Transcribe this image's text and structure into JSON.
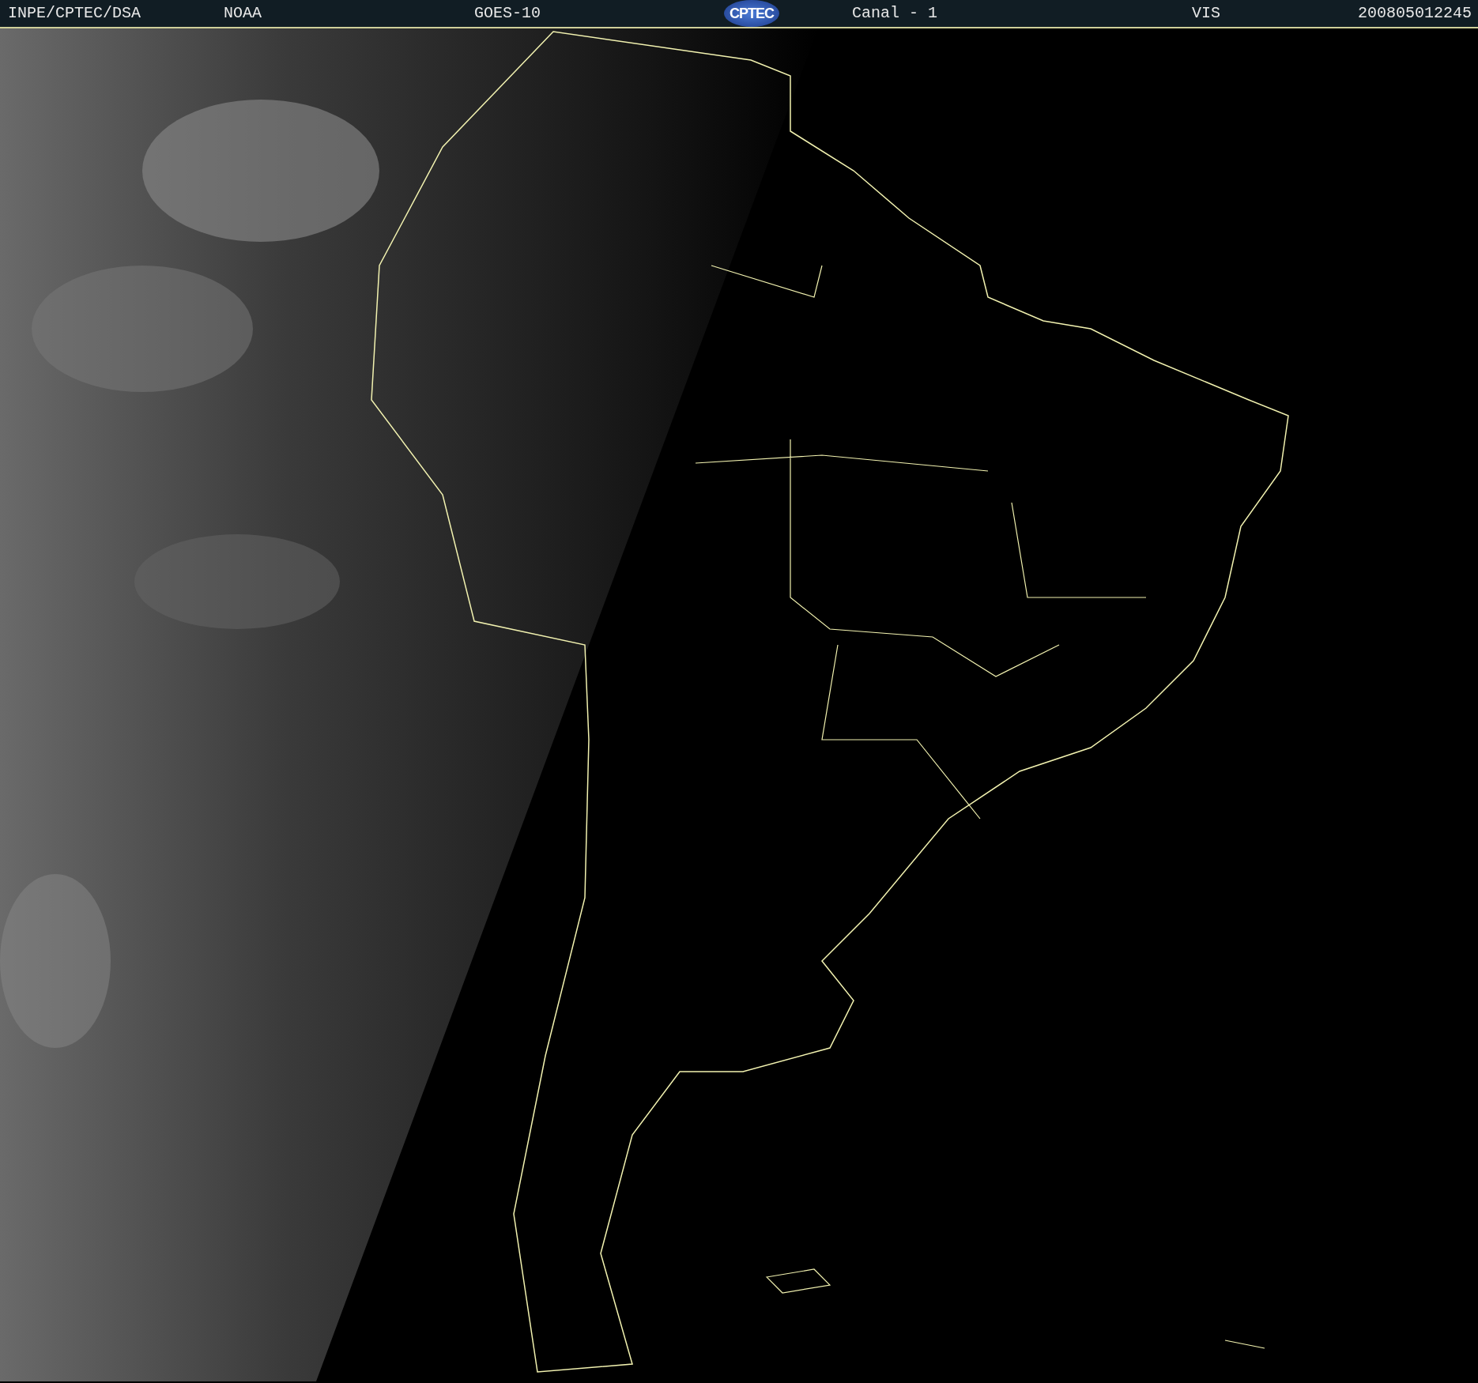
{
  "header": {
    "source": "INPE/CPTEC/DSA",
    "agency": "NOAA",
    "satellite": "GOES-10",
    "logo": "CPTEC",
    "channel": "Canal - 1",
    "band": "VIS",
    "timestamp": "200805012245"
  }
}
